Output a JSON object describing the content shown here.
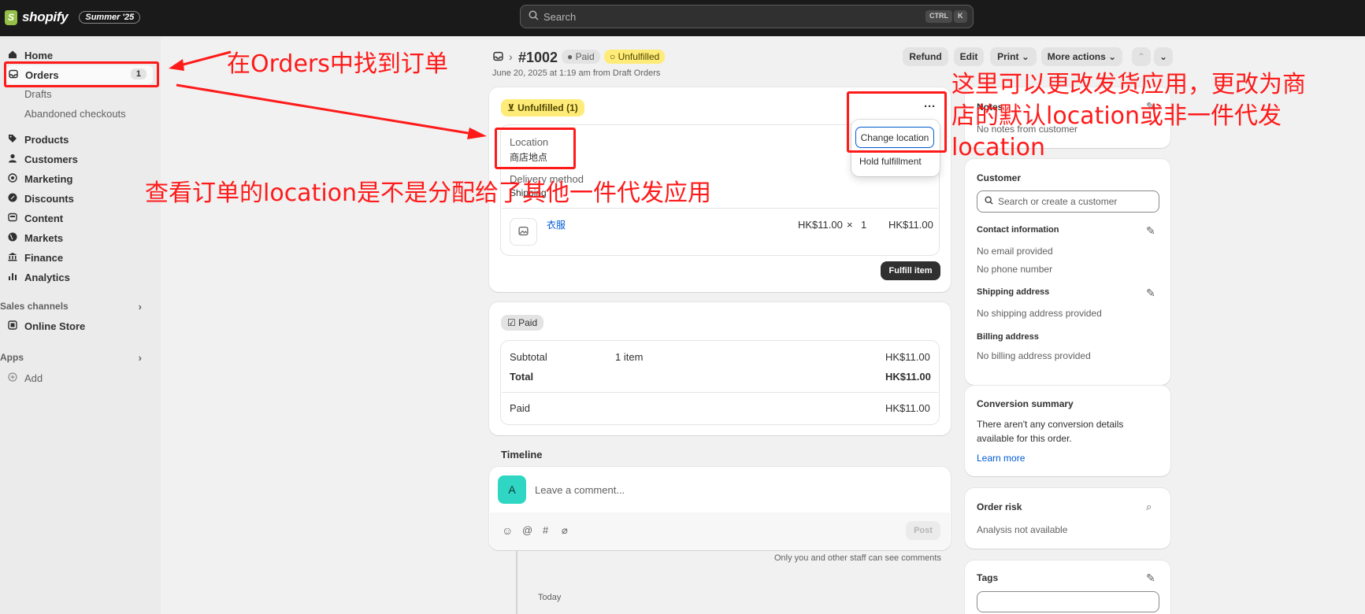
{
  "topbar": {
    "brand": "shopify",
    "edition": "Summer '25",
    "search_placeholder": "Search",
    "kbd_ctrl": "CTRL",
    "kbd_k": "K"
  },
  "sidebar": {
    "home": "Home",
    "orders": "Orders",
    "orders_count": "1",
    "drafts": "Drafts",
    "abandoned": "Abandoned checkouts",
    "products": "Products",
    "customers": "Customers",
    "marketing": "Marketing",
    "discounts": "Discounts",
    "content": "Content",
    "markets": "Markets",
    "finance": "Finance",
    "analytics": "Analytics",
    "sales_channels": "Sales channels",
    "online_store": "Online Store",
    "apps": "Apps",
    "add": "Add"
  },
  "header": {
    "order_number": "#1002",
    "paid_badge": "Paid",
    "unfulfilled_badge": "Unfulfilled",
    "subtitle": "June 20, 2025 at 1:19 am from Draft Orders",
    "refund": "Refund",
    "edit": "Edit",
    "print": "Print",
    "more_actions": "More actions"
  },
  "fulfillment": {
    "status": "Unfulfilled (1)",
    "location_label": "Location",
    "location_value": "商店地点",
    "delivery_label": "Delivery method",
    "delivery_value": "Shipping",
    "item_name": "衣服",
    "item_price": "HK$11.00",
    "item_times": "×",
    "item_qty": "1",
    "item_total": "HK$11.00",
    "fulfill_button": "Fulfill item",
    "menu": {
      "change_location": "Change location",
      "hold_fulfillment": "Hold fulfillment"
    }
  },
  "payment": {
    "status": "Paid",
    "subtotal_label": "Subtotal",
    "subtotal_items": "1 item",
    "subtotal_value": "HK$11.00",
    "total_label": "Total",
    "total_value": "HK$11.00",
    "paid_label": "Paid",
    "paid_value": "HK$11.00"
  },
  "timeline": {
    "title": "Timeline",
    "avatar": "A",
    "comment_placeholder": "Leave a comment...",
    "post": "Post",
    "staff_note": "Only you and other staff can see comments",
    "today": "Today"
  },
  "right": {
    "notes_title": "Notes",
    "notes_value": "No notes from customer",
    "customer_title": "Customer",
    "customer_search_placeholder": "Search or create a customer",
    "contact_title": "Contact information",
    "no_email": "No email provided",
    "no_phone": "No phone number",
    "shipping_title": "Shipping address",
    "no_shipping": "No shipping address provided",
    "billing_title": "Billing address",
    "no_billing": "No billing address provided",
    "conversion_title": "Conversion summary",
    "conversion_text_1": "There aren't any conversion details",
    "conversion_text_2": "available for this order.",
    "learn_more": "Learn more",
    "risk_title": "Order risk",
    "risk_value": "Analysis not available",
    "tags_title": "Tags"
  },
  "annotations": {
    "orders_note": "在Orders中找到订单",
    "location_note": "查看订单的location是不是分配给了其他一件代发应用",
    "change_note_1": "这里可以更改发货应用，更改为商",
    "change_note_2": "店的默认location或非一件代发",
    "change_note_3": "location"
  },
  "colors": {
    "annotation_red": "#ff1a1a",
    "topbar": "#1a1a1a",
    "unfulfilled_yellow": "#ffeb78",
    "avatar_teal": "#2fd6c3",
    "link_blue": "#005bd3"
  }
}
